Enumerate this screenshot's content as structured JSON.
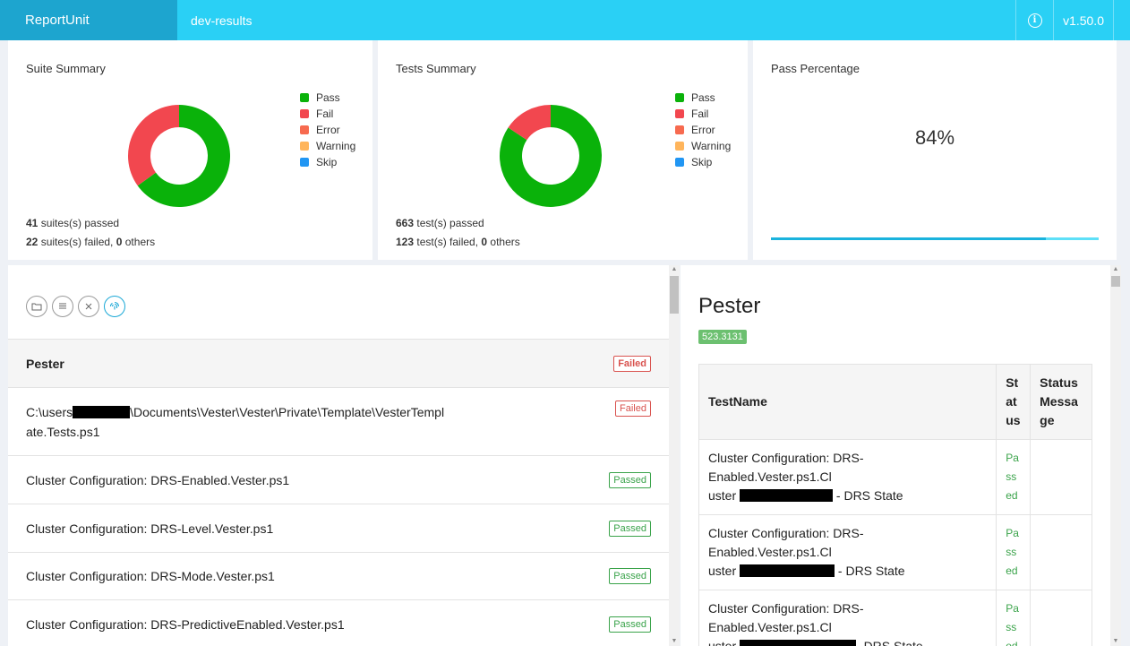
{
  "header": {
    "brand": "ReportUnit",
    "project": "dev-results",
    "info_icon": "info-icon",
    "version": "v1.50.0"
  },
  "colors": {
    "pass": "#0ab20a",
    "fail": "#f2474f",
    "error": "#f76a4f",
    "warning": "#ffb55c",
    "skip": "#2196f3",
    "accent": "#2ad0f5"
  },
  "suite_summary": {
    "title": "Suite Summary",
    "legend": [
      "Pass",
      "Fail",
      "Error",
      "Warning",
      "Skip"
    ],
    "passed_count": "41",
    "passed_text": " suites(s) passed",
    "failed_count": "22",
    "failed_text": " suites(s) failed, ",
    "others_count": "0",
    "others_text": " others"
  },
  "tests_summary": {
    "title": "Tests Summary",
    "legend": [
      "Pass",
      "Fail",
      "Error",
      "Warning",
      "Skip"
    ],
    "passed_count": "663",
    "passed_text": " test(s) passed",
    "failed_count": "123",
    "failed_text": " test(s) failed, ",
    "others_count": "0",
    "others_text": " others"
  },
  "pass_percentage": {
    "title": "Pass Percentage",
    "value": "84%",
    "progress": 0.84
  },
  "chart_data": [
    {
      "type": "pie",
      "title": "Suite Summary",
      "categories": [
        "Pass",
        "Fail",
        "Error",
        "Warning",
        "Skip"
      ],
      "values": [
        41,
        22,
        0,
        0,
        0
      ]
    },
    {
      "type": "pie",
      "title": "Tests Summary",
      "categories": [
        "Pass",
        "Fail",
        "Error",
        "Warning",
        "Skip"
      ],
      "values": [
        663,
        123,
        0,
        0,
        0
      ]
    }
  ],
  "toolbar": {
    "icons": [
      "folder-icon",
      "list-icon",
      "close-icon",
      "fingerprint-icon"
    ]
  },
  "suites": {
    "header": {
      "name": "Pester",
      "status": "Failed"
    },
    "items": [
      {
        "name_part1": "C:\\users",
        "name_part2": "\\Documents\\Vester\\Vester\\Private\\Template\\VesterTempl",
        "name_part3": "ate.Tests.ps1",
        "status": "Failed"
      },
      {
        "name": "Cluster Configuration: DRS-Enabled.Vester.ps1",
        "status": "Passed"
      },
      {
        "name": "Cluster Configuration: DRS-Level.Vester.ps1",
        "status": "Passed"
      },
      {
        "name": "Cluster Configuration: DRS-Mode.Vester.ps1",
        "status": "Passed"
      },
      {
        "name": "Cluster Configuration: DRS-PredictiveEnabled.Vester.ps1",
        "status": "Passed"
      }
    ]
  },
  "detail": {
    "title": "Pester",
    "duration": "523.3131",
    "columns": [
      "TestName",
      "Status",
      "Status Message"
    ],
    "rows": [
      {
        "name_a": "Cluster Configuration: DRS-Enabled.Vester.ps1.Cl",
        "name_b": "uster ",
        "name_c": " - DRS State",
        "status": "Passed"
      },
      {
        "name_a": "Cluster Configuration: DRS-Enabled.Vester.ps1.Cl",
        "name_b": "uster ",
        "name_c": " - DRS State",
        "status": "Passed"
      },
      {
        "name_a": "Cluster Configuration: DRS-Enabled.Vester.ps1.Cl",
        "name_b": "uster ",
        "name_c": "- DRS State",
        "status": "Passed"
      }
    ]
  }
}
